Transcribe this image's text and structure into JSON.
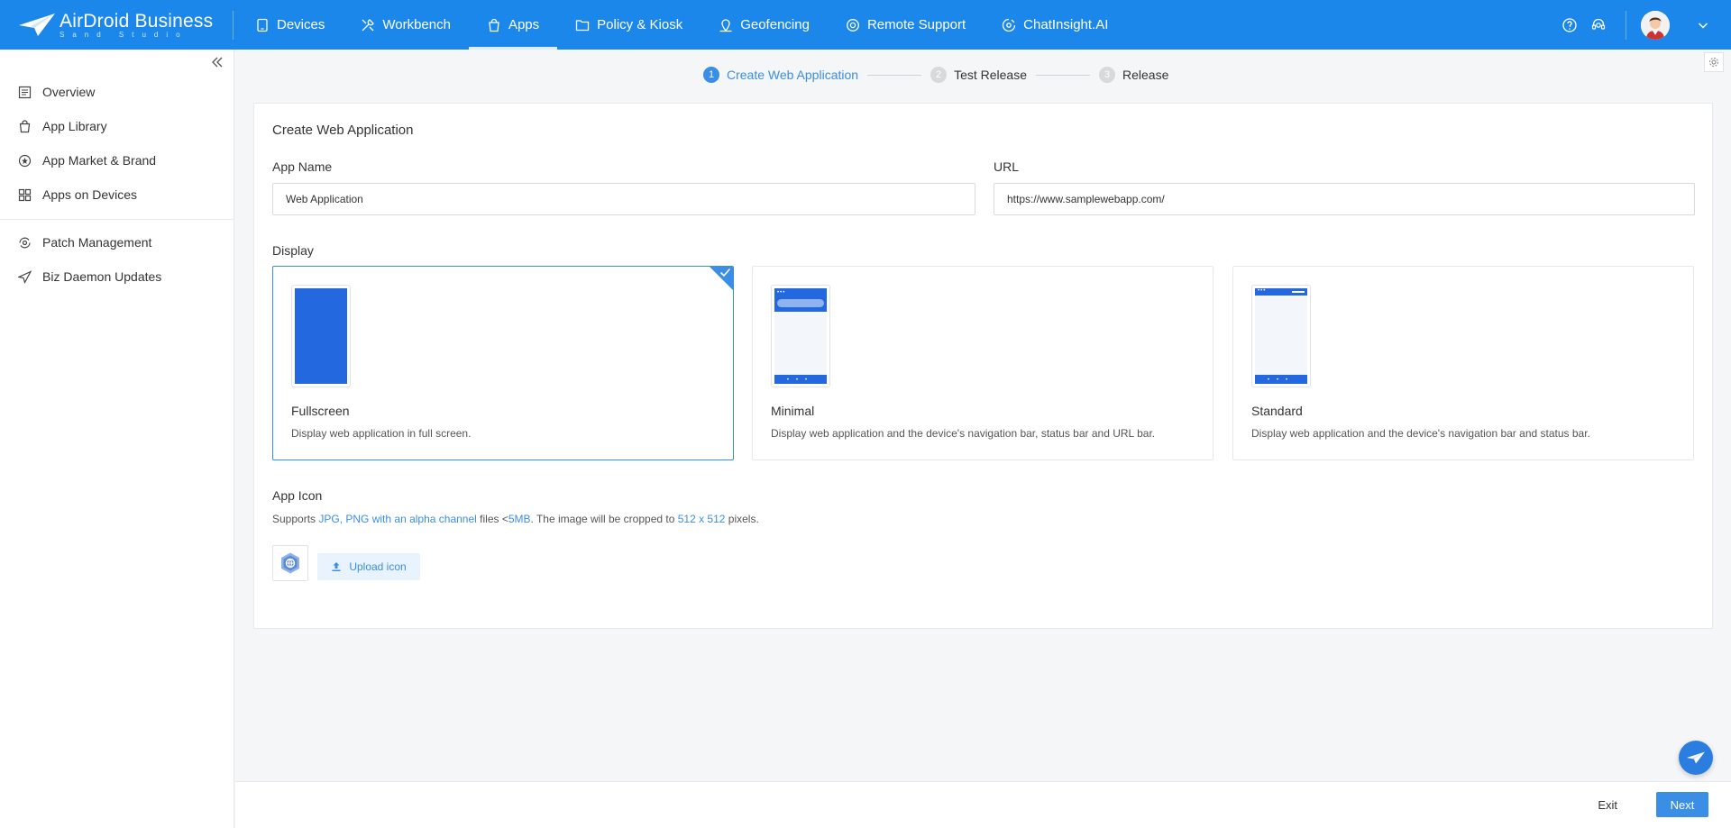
{
  "app": {
    "logo_text": "AirDroid Business",
    "logo_subtext": "Sand Studio"
  },
  "topnav": [
    {
      "label": "Devices",
      "icon": "tablet-icon"
    },
    {
      "label": "Workbench",
      "icon": "tools-icon"
    },
    {
      "label": "Apps",
      "icon": "bag-icon",
      "active": true
    },
    {
      "label": "Policy & Kiosk",
      "icon": "folder-icon"
    },
    {
      "label": "Geofencing",
      "icon": "map-pin-icon"
    },
    {
      "label": "Remote Support",
      "icon": "lifebuoy-icon"
    },
    {
      "label": "ChatInsight.AI",
      "icon": "ai-chat-icon"
    }
  ],
  "sidebar": {
    "items": [
      {
        "label": "Overview",
        "icon": "list-icon"
      },
      {
        "label": "App Library",
        "icon": "bag-icon"
      },
      {
        "label": "App Market & Brand",
        "icon": "badge-icon"
      },
      {
        "label": "Apps on Devices",
        "icon": "grid-icon"
      },
      {
        "label": "Patch Management",
        "icon": "patch-icon"
      },
      {
        "label": "Biz Daemon Updates",
        "icon": "send-icon"
      }
    ]
  },
  "steps": [
    {
      "num": "1",
      "label": "Create Web Application",
      "active": true
    },
    {
      "num": "2",
      "label": "Test Release"
    },
    {
      "num": "3",
      "label": "Release"
    }
  ],
  "form": {
    "title": "Create Web Application",
    "app_name_label": "App Name",
    "app_name_value": "Web Application",
    "url_label": "URL",
    "url_value": "https://www.samplewebapp.com/",
    "display_label": "Display",
    "display_options": [
      {
        "title": "Fullscreen",
        "desc": "Display web application in full screen.",
        "selected": true
      },
      {
        "title": "Minimal",
        "desc": "Display web application and the device's navigation bar, status bar and URL bar."
      },
      {
        "title": "Standard",
        "desc": "Display web application and the device's navigation bar and status bar."
      }
    ],
    "app_icon_label": "App Icon",
    "support": {
      "prefix": "Supports ",
      "formats": "JPG, PNG with an alpha channel",
      "mid1": " files <",
      "size": "5MB",
      "mid2": ". The image will be cropped to ",
      "dims": "512 x 512",
      "suffix": " pixels."
    },
    "upload_label": "Upload icon"
  },
  "footer": {
    "exit_label": "Exit",
    "next_label": "Next"
  },
  "colors": {
    "brand": "#1c87eb",
    "accent": "#3a8ee6",
    "phone_blue": "#2468e0"
  }
}
